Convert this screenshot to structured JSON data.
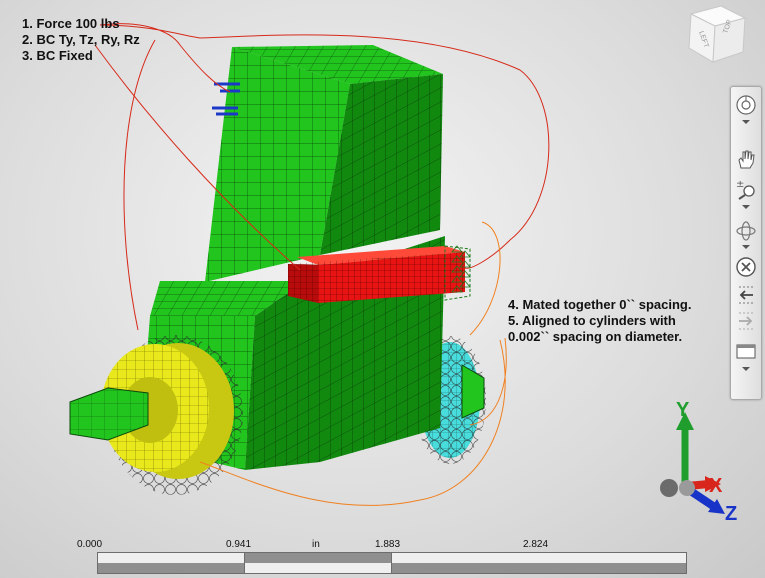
{
  "notes_left": [
    "1. Force 100 lbs",
    "2. BC Ty, Tz, Ry, Rz",
    "3. BC Fixed"
  ],
  "notes_right": [
    "4.  Mated together 0`` spacing.",
    "5. Aligned to cylinders with",
    "0.002`` spacing on diameter."
  ],
  "viewcube": {
    "left_face": "LEFT",
    "top_face": "TOP"
  },
  "triad": {
    "y_label": "Y",
    "x_label": "X",
    "z_label": "Z",
    "colors": {
      "y": "#1f9e2e",
      "x": "#d8261c",
      "z": "#1834c8"
    }
  },
  "scalebar": {
    "ticks": [
      "0.000",
      "0.941",
      "1.883",
      "2.824"
    ],
    "unit": "in"
  },
  "nav_toolbar": {
    "icons": [
      "orbit-wheel-icon",
      "pan-hand-icon",
      "zoom-icon",
      "orbit-icon",
      "center-icon",
      "previous-view-icon",
      "next-view-icon",
      "view-select-icon"
    ]
  },
  "colors": {
    "mesh_green": "#22c41e",
    "mesh_dark_green": "#11890f",
    "cylinder_yellow": "#e9e81c",
    "cylinder_cyan": "#49dcdc",
    "bar_red": "#e81414",
    "callout_red": "#d62a1a",
    "callout_orange": "#f08020",
    "force_blue": "#1c38c8"
  }
}
